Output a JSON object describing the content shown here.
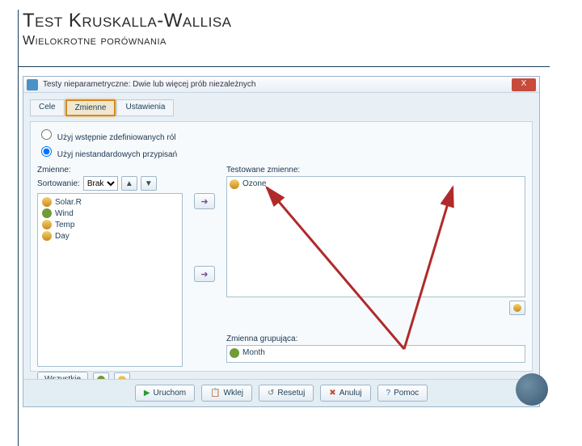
{
  "slide": {
    "title": "Test Kruskalla-Wallisa",
    "subtitle": "Wielokrotne porównania"
  },
  "window": {
    "title": "Testy nieparametryczne: Dwie lub więcej prób niezależnych",
    "close": "X"
  },
  "tabs": {
    "t0": "Cele",
    "t1": "Zmienne",
    "t2": "Ustawienia"
  },
  "radios": {
    "r0": "Użyj wstępnie zdefiniowanych ról",
    "r1": "Użyj niestandardowych przypisań"
  },
  "labels": {
    "vars": "Zmienne:",
    "sort": "Sortowanie:",
    "tested": "Testowane zmienne:",
    "group": "Zmienna grupująca:"
  },
  "sort": {
    "value": "Brak"
  },
  "varlist": {
    "i0": "Solar.R",
    "i1": "Wind",
    "i2": "Temp",
    "i3": "Day"
  },
  "tested": {
    "i0": "Ozone"
  },
  "grouping": {
    "i0": "Month"
  },
  "bottom": {
    "all": "Wszystkie"
  },
  "footer": {
    "run": "Uruchom",
    "paste": "Wklej",
    "reset": "Resetuj",
    "cancel": "Anuluj",
    "help": "Pomoc"
  }
}
